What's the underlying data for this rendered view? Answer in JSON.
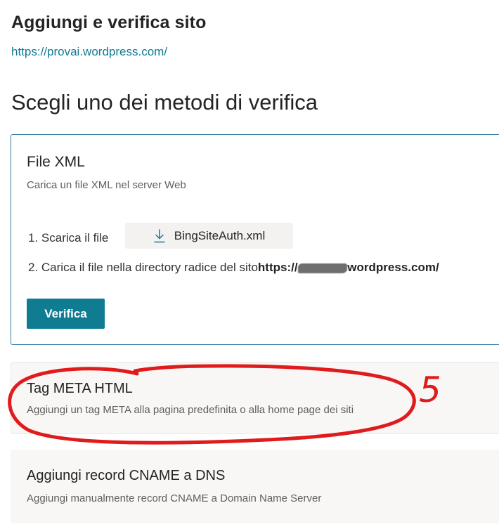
{
  "header": {
    "title": "Aggiungi e verifica sito",
    "site_url": "https://provai.wordpress.com/"
  },
  "section_title": "Scegli uno dei metodi di verifica",
  "methods": {
    "xml": {
      "title": "File XML",
      "subtitle": "Carica un file XML nel server Web",
      "step1_label": "1. Scarica il file",
      "download_filename": "BingSiteAuth.xml",
      "step2_label": "2. Carica il file nella directory radice del sito",
      "step2_url_prefix": "https://",
      "step2_url_suffix": ".wordpress.com/",
      "verify_label": "Verifica"
    },
    "meta": {
      "title": "Tag META HTML",
      "subtitle": "Aggiungi un tag META alla pagina predefinita o alla home page dei siti"
    },
    "cname": {
      "title": "Aggiungi record CNAME a DNS",
      "subtitle": "Aggiungi manualmente record CNAME a Domain Name Server"
    }
  },
  "annotation": {
    "number": "5",
    "color": "#e01b1b"
  },
  "colors": {
    "accent": "#0f7c91",
    "link": "#0f7a94",
    "selected_border": "#2f7fa2"
  },
  "icons": {
    "download": "download-icon"
  }
}
